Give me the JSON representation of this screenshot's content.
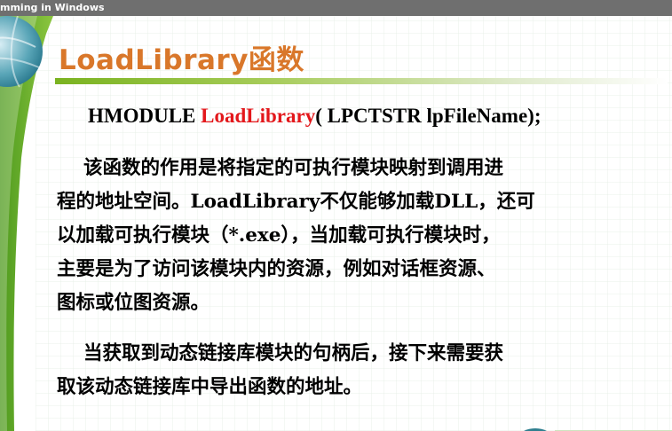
{
  "header": {
    "text": "mming in Windows"
  },
  "slide": {
    "title": "LoadLibrary函数",
    "title_color": "#d9772a",
    "accent_green": "#7ab320",
    "signature": {
      "return_type": "HMODULE",
      "function_name": "LoadLibrary",
      "params": "( LPCTSTR lpFileName);",
      "function_color": "#e3171b"
    },
    "paragraph1": [
      "    该函数的作用是将指定的可执行模块映射到调用进",
      "程的地址空间。LoadLibrary不仅能够加载DLL，还可",
      "以加载可执行模块（*.exe），当加载可执行模块时，",
      "主要是为了访问该模块内的资源，例如对话框资源、",
      "图标或位图资源。"
    ],
    "paragraph2": [
      "    当获取到动态链接库模块的句柄后，接下来需要获",
      "取该动态链接库中导出函数的地址。"
    ]
  }
}
